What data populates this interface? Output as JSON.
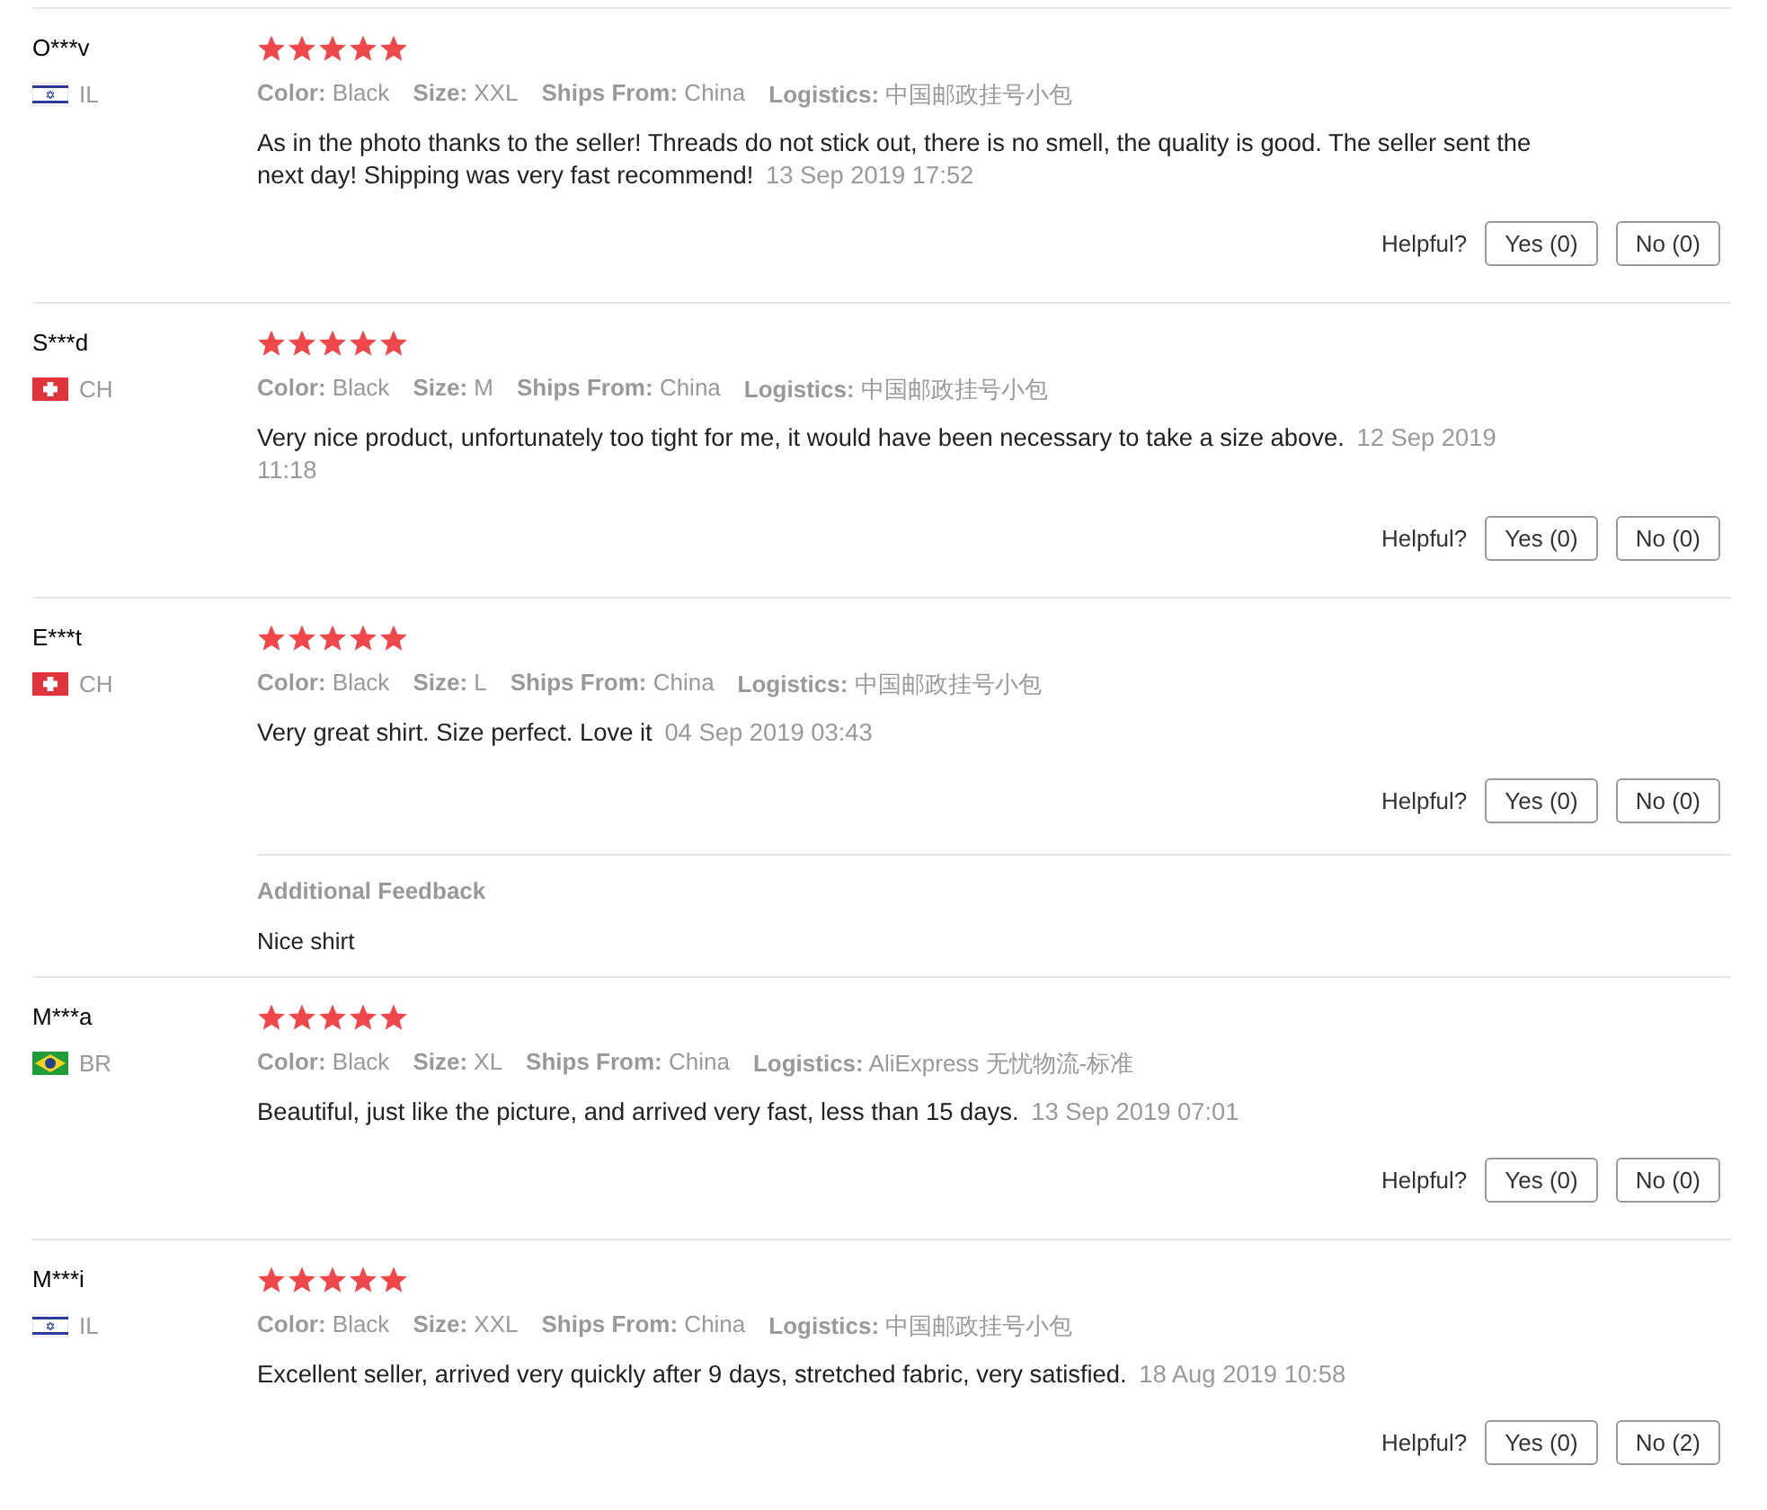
{
  "reviews": [
    {
      "name": "O***v",
      "kind": "il",
      "country": "IL",
      "stars": 5,
      "attributes": [
        {
          "label": "Color:",
          "value": "Black"
        },
        {
          "label": "Size:",
          "value": "XXL"
        },
        {
          "label": "Ships From:",
          "value": "China"
        },
        {
          "label": "Logistics:",
          "value": "中国邮政挂号小包"
        }
      ],
      "text": "As in the photo thanks to the seller! Threads do not stick out, there is no smell, the quality is good. The seller sent the next day! Shipping was very fast recommend!",
      "date": "13 Sep 2019 17:52",
      "helpful": "Helpful?",
      "yes": "Yes (0)",
      "no": "No (0)"
    },
    {
      "name": "S***d",
      "kind": "ch",
      "country": "CH",
      "stars": 5,
      "attributes": [
        {
          "label": "Color:",
          "value": "Black"
        },
        {
          "label": "Size:",
          "value": "M"
        },
        {
          "label": "Ships From:",
          "value": "China"
        },
        {
          "label": "Logistics:",
          "value": "中国邮政挂号小包"
        }
      ],
      "text": "Very nice product, unfortunately too tight for me, it would have been necessary to take a size above.",
      "date": "12 Sep 2019 11:18",
      "helpful": "Helpful?",
      "yes": "Yes (0)",
      "no": "No (0)"
    },
    {
      "name": "E***t",
      "kind": "ch",
      "country": "CH",
      "stars": 5,
      "attributes": [
        {
          "label": "Color:",
          "value": "Black"
        },
        {
          "label": "Size:",
          "value": "L"
        },
        {
          "label": "Ships From:",
          "value": "China"
        },
        {
          "label": "Logistics:",
          "value": "中国邮政挂号小包"
        }
      ],
      "text": "Very great shirt. Size perfect. Love it",
      "date": "04 Sep 2019 03:43",
      "helpful": "Helpful?",
      "yes": "Yes (0)",
      "no": "No (0)",
      "additional_feedback": {
        "title": "Additional Feedback",
        "text": "Nice shirt"
      }
    },
    {
      "name": "M***a",
      "kind": "br",
      "country": "BR",
      "stars": 5,
      "attributes": [
        {
          "label": "Color:",
          "value": "Black"
        },
        {
          "label": "Size:",
          "value": "XL"
        },
        {
          "label": "Ships From:",
          "value": "China"
        },
        {
          "label": "Logistics:",
          "value": "AliExpress 无忧物流-标准"
        }
      ],
      "text": "Beautiful, just like the picture, and arrived very fast, less than 15 days.",
      "date": "13 Sep 2019 07:01",
      "helpful": "Helpful?",
      "yes": "Yes (0)",
      "no": "No (0)"
    },
    {
      "name": "M***i",
      "kind": "il",
      "country": "IL",
      "stars": 5,
      "attributes": [
        {
          "label": "Color:",
          "value": "Black"
        },
        {
          "label": "Size:",
          "value": "XXL"
        },
        {
          "label": "Ships From:",
          "value": "China"
        },
        {
          "label": "Logistics:",
          "value": "中国邮政挂号小包"
        }
      ],
      "text": "Excellent seller, arrived very quickly after 9 days, stretched fabric, very satisfied.",
      "date": "18 Aug 2019 10:58",
      "helpful": "Helpful?",
      "yes": "Yes (0)",
      "no": "No (2)"
    }
  ]
}
